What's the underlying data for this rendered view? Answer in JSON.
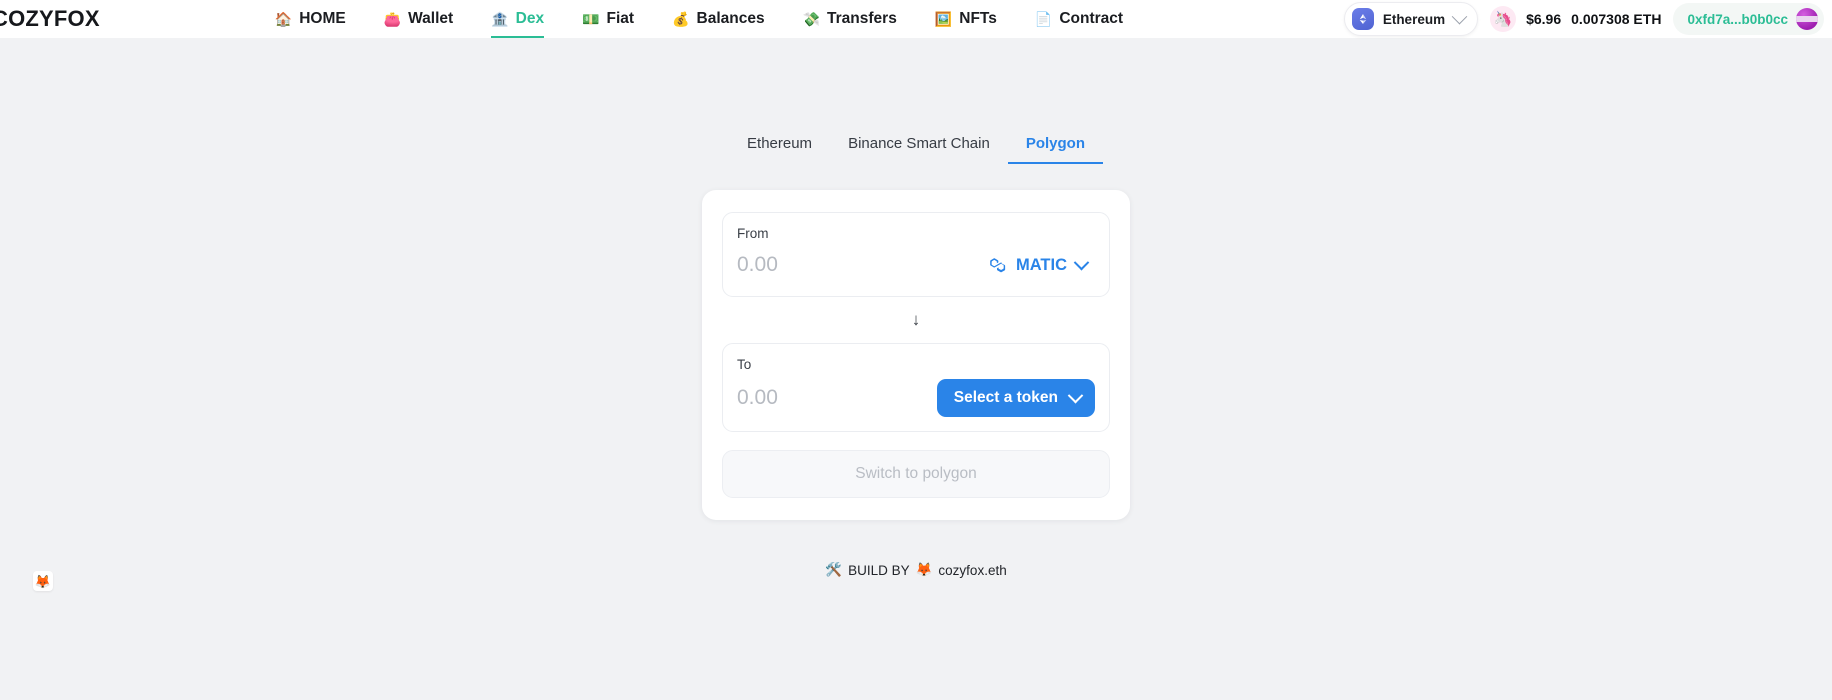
{
  "header": {
    "logo": "COZYFOX",
    "nav": [
      {
        "label": "HOME",
        "icon": "🏠",
        "icon_name": "house-icon",
        "active": false
      },
      {
        "label": "Wallet",
        "icon": "👛",
        "icon_name": "purse-icon",
        "active": false
      },
      {
        "label": "Dex",
        "icon": "🏦",
        "icon_name": "bank-icon",
        "active": true
      },
      {
        "label": "Fiat",
        "icon": "💵",
        "icon_name": "banknote-icon",
        "active": false
      },
      {
        "label": "Balances",
        "icon": "💰",
        "icon_name": "moneybag-icon",
        "active": false
      },
      {
        "label": "Transfers",
        "icon": "💸",
        "icon_name": "money-wings-icon",
        "active": false
      },
      {
        "label": "NFTs",
        "icon": "🖼️",
        "icon_name": "framed-picture-icon",
        "active": false
      },
      {
        "label": "Contract",
        "icon": "📄",
        "icon_name": "document-icon",
        "active": false
      }
    ],
    "chain_selector": {
      "label": "Ethereum",
      "icon_name": "ethereum-icon"
    },
    "balance": {
      "usd": "$6.96",
      "native": "0.007308 ETH",
      "icon_name": "unicorn-icon",
      "icon": "🦄"
    },
    "account": {
      "address": "0xfd7a...b0b0cc",
      "avatar_name": "wallet-avatar"
    }
  },
  "main": {
    "chain_tabs": [
      {
        "label": "Ethereum",
        "active": false
      },
      {
        "label": "Binance Smart Chain",
        "active": false
      },
      {
        "label": "Polygon",
        "active": true
      }
    ],
    "swap": {
      "from": {
        "label": "From",
        "amount_value": "",
        "amount_placeholder": "0.00",
        "token": "MATIC",
        "token_icon_name": "matic-icon"
      },
      "direction_arrow": "↓",
      "to": {
        "label": "To",
        "amount_value": "",
        "amount_placeholder": "0.00",
        "token_button_label": "Select a token"
      },
      "action_button": "Switch to polygon"
    }
  },
  "footer": {
    "build_icon": "🛠️",
    "build_text": "BUILD BY",
    "author_icon": "🦊",
    "author": "cozyfox.eth"
  },
  "corner_widget": {
    "icon": "🦊",
    "name": "fox-widget-icon"
  },
  "colors": {
    "accent_blue": "#2a84e8",
    "accent_green": "#2bbd95",
    "page_bg": "#f1f2f4",
    "card_bg": "#ffffff"
  }
}
